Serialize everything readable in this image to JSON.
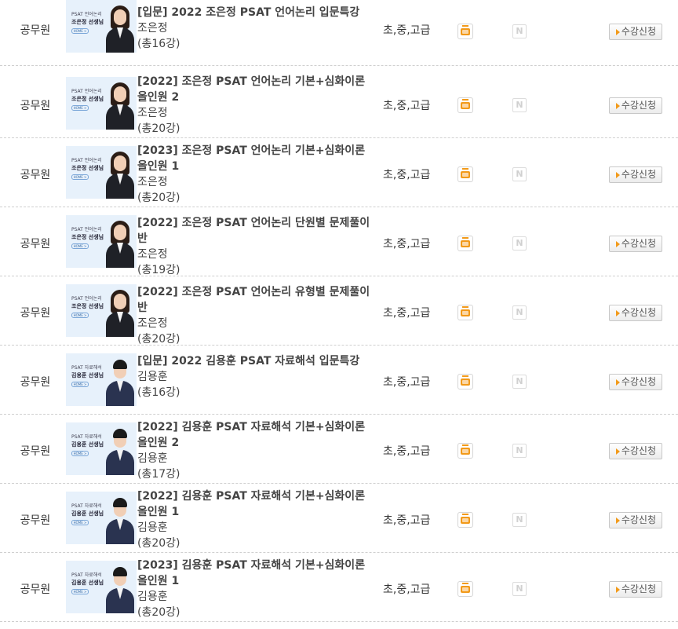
{
  "courses": [
    {
      "category": "공무원",
      "title": "[입문] 2022 조은정 PSAT 언어논리 입문특강",
      "instructor": "조은정",
      "count": "(총16강)",
      "level": "초,중,고급",
      "button": "수강신청",
      "thumb_subject": "PSAT 언어논리",
      "thumb_name": "조은정 선생님",
      "thumb_badge": "HOME >"
    },
    {
      "category": "공무원",
      "title": "[2022] 조은정 PSAT 언어논리 기본+심화이론 올인원 2",
      "instructor": "조은정",
      "count": "(총20강)",
      "level": "초,중,고급",
      "button": "수강신청",
      "thumb_subject": "PSAT 언어논리",
      "thumb_name": "조은정 선생님",
      "thumb_badge": "HOME >"
    },
    {
      "category": "공무원",
      "title": "[2023] 조은정 PSAT 언어논리 기본+심화이론 올인원 1",
      "instructor": "조은정",
      "count": "(총20강)",
      "level": "초,중,고급",
      "button": "수강신청",
      "thumb_subject": "PSAT 언어논리",
      "thumb_name": "조은정 선생님",
      "thumb_badge": "HOME >"
    },
    {
      "category": "공무원",
      "title": "[2022] 조은정 PSAT 언어논리 단원별 문제풀이반",
      "instructor": "조은정",
      "count": "(총19강)",
      "level": "초,중,고급",
      "button": "수강신청",
      "thumb_subject": "PSAT 언어논리",
      "thumb_name": "조은정 선생님",
      "thumb_badge": "HOME >"
    },
    {
      "category": "공무원",
      "title": "[2022] 조은정 PSAT 언어논리 유형별 문제풀이반",
      "instructor": "조은정",
      "count": "(총20강)",
      "level": "초,중,고급",
      "button": "수강신청",
      "thumb_subject": "PSAT 언어논리",
      "thumb_name": "조은정 선생님",
      "thumb_badge": "HOME >"
    },
    {
      "category": "공무원",
      "title": "[입문] 2022 김용훈 PSAT 자료해석 입문특강",
      "instructor": "김용훈",
      "count": "(총16강)",
      "level": "초,중,고급",
      "button": "수강신청",
      "thumb_subject": "PSAT 자료해석",
      "thumb_name": "김용훈 선생님",
      "thumb_badge": "HOME >"
    },
    {
      "category": "공무원",
      "title": "[2022] 김용훈 PSAT 자료해석 기본+심화이론 올인원 2",
      "instructor": "김용훈",
      "count": "(총17강)",
      "level": "초,중,고급",
      "button": "수강신청",
      "thumb_subject": "PSAT 자료해석",
      "thumb_name": "김용훈 선생님",
      "thumb_badge": "HOME >"
    },
    {
      "category": "공무원",
      "title": "[2022] 김용훈 PSAT 자료해석 기본+심화이론 올인원 1",
      "instructor": "김용훈",
      "count": "(총20강)",
      "level": "초,중,고급",
      "button": "수강신청",
      "thumb_subject": "PSAT 자료해석",
      "thumb_name": "김용훈 선생님",
      "thumb_badge": "HOME >"
    },
    {
      "category": "공무원",
      "title": "[2023] 김용훈 PSAT 자료해석 기본+심화이론 올인원 1",
      "instructor": "김용훈",
      "count": "(총20강)",
      "level": "초,중,고급",
      "button": "수강신청",
      "thumb_subject": "PSAT 자료해석",
      "thumb_name": "김용훈 선생님",
      "thumb_badge": "HOME >"
    }
  ],
  "icons": {
    "video": "tv-icon",
    "mobile": "mobile-n-icon",
    "mobile_letter": "N"
  },
  "colors": {
    "accent": "#f29a1a",
    "thumb_bg": "#e7f1fb",
    "divider": "#cfcfcf"
  }
}
